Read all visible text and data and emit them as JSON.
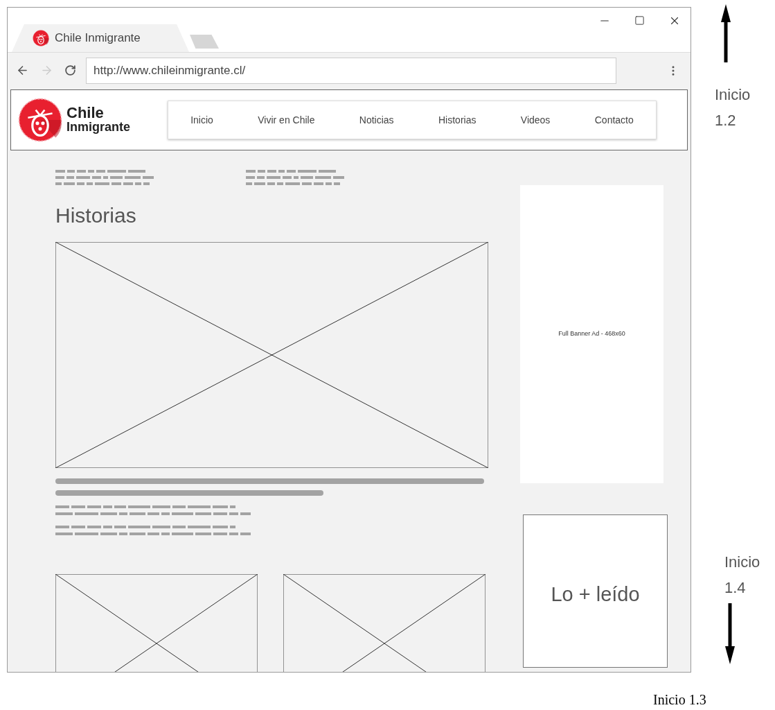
{
  "browser": {
    "tab_title": "Chile Inmigrante",
    "url": "http://www.chileinmigrante.cl/"
  },
  "site": {
    "logo": {
      "line1": "Chile",
      "line2": "Inmigrante"
    },
    "nav": [
      "Inicio",
      "Vivir en Chile",
      "Noticias",
      "Historias",
      "Videos",
      "Contacto"
    ],
    "heading": "Historias",
    "ad": "Full Banner Ad - 468x60",
    "most_read": "Lo + leído"
  },
  "annotations": {
    "top": "Inicio 1.2",
    "right": "Inicio 1.4",
    "bottom": "Inicio 1.3"
  }
}
